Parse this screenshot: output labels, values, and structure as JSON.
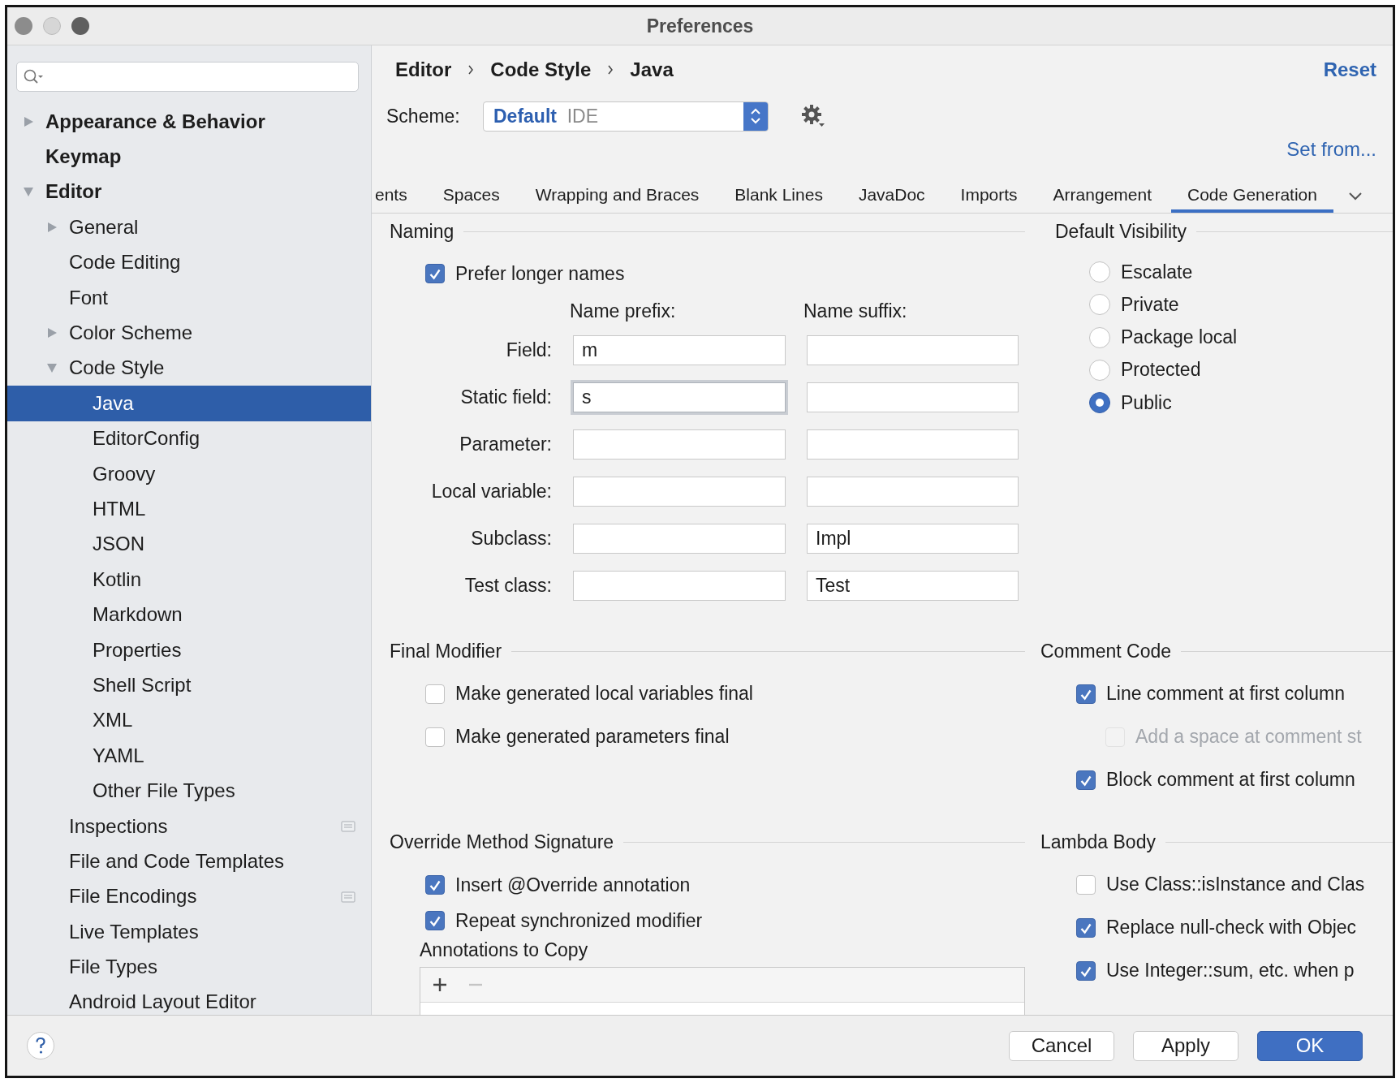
{
  "window": {
    "title": "Preferences"
  },
  "sidebar": {
    "items": [
      {
        "label": "Appearance & Behavior",
        "expanded": false,
        "selected": false
      },
      {
        "label": "Keymap",
        "selected": false
      },
      {
        "label": "Editor",
        "expanded": true,
        "selected": false,
        "children": [
          {
            "label": "General",
            "expanded": false,
            "selected": false
          },
          {
            "label": "Code Editing",
            "selected": false
          },
          {
            "label": "Font",
            "selected": false
          },
          {
            "label": "Color Scheme",
            "expanded": false,
            "selected": false
          },
          {
            "label": "Code Style",
            "expanded": true,
            "selected": false,
            "children": [
              {
                "label": "Java",
                "selected": true
              },
              {
                "label": "EditorConfig",
                "selected": false
              },
              {
                "label": "Groovy",
                "selected": false
              },
              {
                "label": "HTML",
                "selected": false
              },
              {
                "label": "JSON",
                "selected": false
              },
              {
                "label": "Kotlin",
                "selected": false
              },
              {
                "label": "Markdown",
                "selected": false
              },
              {
                "label": "Properties",
                "selected": false
              },
              {
                "label": "Shell Script",
                "selected": false
              },
              {
                "label": "XML",
                "selected": false
              },
              {
                "label": "YAML",
                "selected": false
              },
              {
                "label": "Other File Types",
                "selected": false
              }
            ]
          },
          {
            "label": "Inspections",
            "selected": false,
            "project_level": true
          },
          {
            "label": "File and Code Templates",
            "selected": false
          },
          {
            "label": "File Encodings",
            "selected": false,
            "project_level": true
          },
          {
            "label": "Live Templates",
            "selected": false
          },
          {
            "label": "File Types",
            "selected": false
          },
          {
            "label": "Android Layout Editor",
            "selected": false
          }
        ]
      }
    ]
  },
  "breadcrumb": [
    "Editor",
    "Code Style",
    "Java"
  ],
  "reset_link": "Reset",
  "scheme": {
    "label": "Scheme:",
    "value": "Default",
    "qualifier": "IDE"
  },
  "set_from_link": "Set from...",
  "tabs": [
    {
      "label": "ents",
      "selected": false
    },
    {
      "label": "Spaces",
      "selected": false
    },
    {
      "label": "Wrapping and Braces",
      "selected": false
    },
    {
      "label": "Blank Lines",
      "selected": false
    },
    {
      "label": "JavaDoc",
      "selected": false
    },
    {
      "label": "Imports",
      "selected": false
    },
    {
      "label": "Arrangement",
      "selected": false
    },
    {
      "label": "Code Generation",
      "selected": true
    }
  ],
  "naming": {
    "title": "Naming",
    "prefer_longer": {
      "label": "Prefer longer names",
      "checked": true
    },
    "prefix_heading": "Name prefix:",
    "suffix_heading": "Name suffix:",
    "rows": [
      {
        "label": "Field:",
        "prefix": {
          "value": "m",
          "focused": false
        },
        "suffix": {
          "focused": false
        }
      },
      {
        "label": "Static field:",
        "prefix": {
          "value": "s",
          "focused": true
        },
        "suffix": {
          "focused": false
        }
      },
      {
        "label": "Parameter:",
        "prefix": {
          "focused": false
        },
        "suffix": {
          "focused": false
        }
      },
      {
        "label": "Local variable:",
        "prefix": {
          "focused": false
        },
        "suffix": {
          "focused": false
        }
      },
      {
        "label": "Subclass:",
        "prefix": {
          "focused": false
        },
        "suffix": {
          "value": "Impl",
          "focused": false
        }
      },
      {
        "label": "Test class:",
        "prefix": {
          "focused": false
        },
        "suffix": {
          "value": "Test",
          "focused": false
        }
      }
    ]
  },
  "default_visibility": {
    "title": "Default Visibility",
    "options": [
      {
        "label": "Escalate",
        "selected": false
      },
      {
        "label": "Private",
        "selected": false
      },
      {
        "label": "Package local",
        "selected": false
      },
      {
        "label": "Protected",
        "selected": false
      },
      {
        "label": "Public",
        "selected": true
      }
    ]
  },
  "final_modifier": {
    "title": "Final Modifier",
    "options": [
      {
        "label": "Make generated local variables final",
        "checked": false
      },
      {
        "label": "Make generated parameters final",
        "checked": false
      }
    ]
  },
  "comment_code": {
    "title": "Comment Code",
    "options": [
      {
        "label": "Line comment at first column",
        "checked": true,
        "disabled": false,
        "children": [
          {
            "label": "Add a space at comment st",
            "checked": false,
            "disabled": true
          }
        ]
      },
      {
        "label": "Block comment at first column",
        "checked": true,
        "disabled": false
      }
    ]
  },
  "override": {
    "title": "Override Method Signature",
    "options": [
      {
        "label": "Insert @Override annotation",
        "checked": true
      },
      {
        "label": "Repeat synchronized modifier",
        "checked": true
      }
    ],
    "annotations": {
      "title": "Annotations to Copy",
      "toolbar": [
        {
          "kind": "add",
          "disabled": false
        },
        {
          "kind": "remove",
          "disabled": true
        }
      ]
    }
  },
  "lambda_body": {
    "title": "Lambda Body",
    "options": [
      {
        "label": "Use Class::isInstance and Clas",
        "checked": false
      },
      {
        "label": "Replace null-check with Objec",
        "checked": true
      },
      {
        "label": "Use Integer::sum, etc. when p",
        "checked": true
      }
    ]
  },
  "buttons": [
    {
      "label": "Cancel",
      "kind": "default"
    },
    {
      "label": "Apply",
      "kind": "default"
    },
    {
      "label": "OK",
      "kind": "primary"
    }
  ]
}
